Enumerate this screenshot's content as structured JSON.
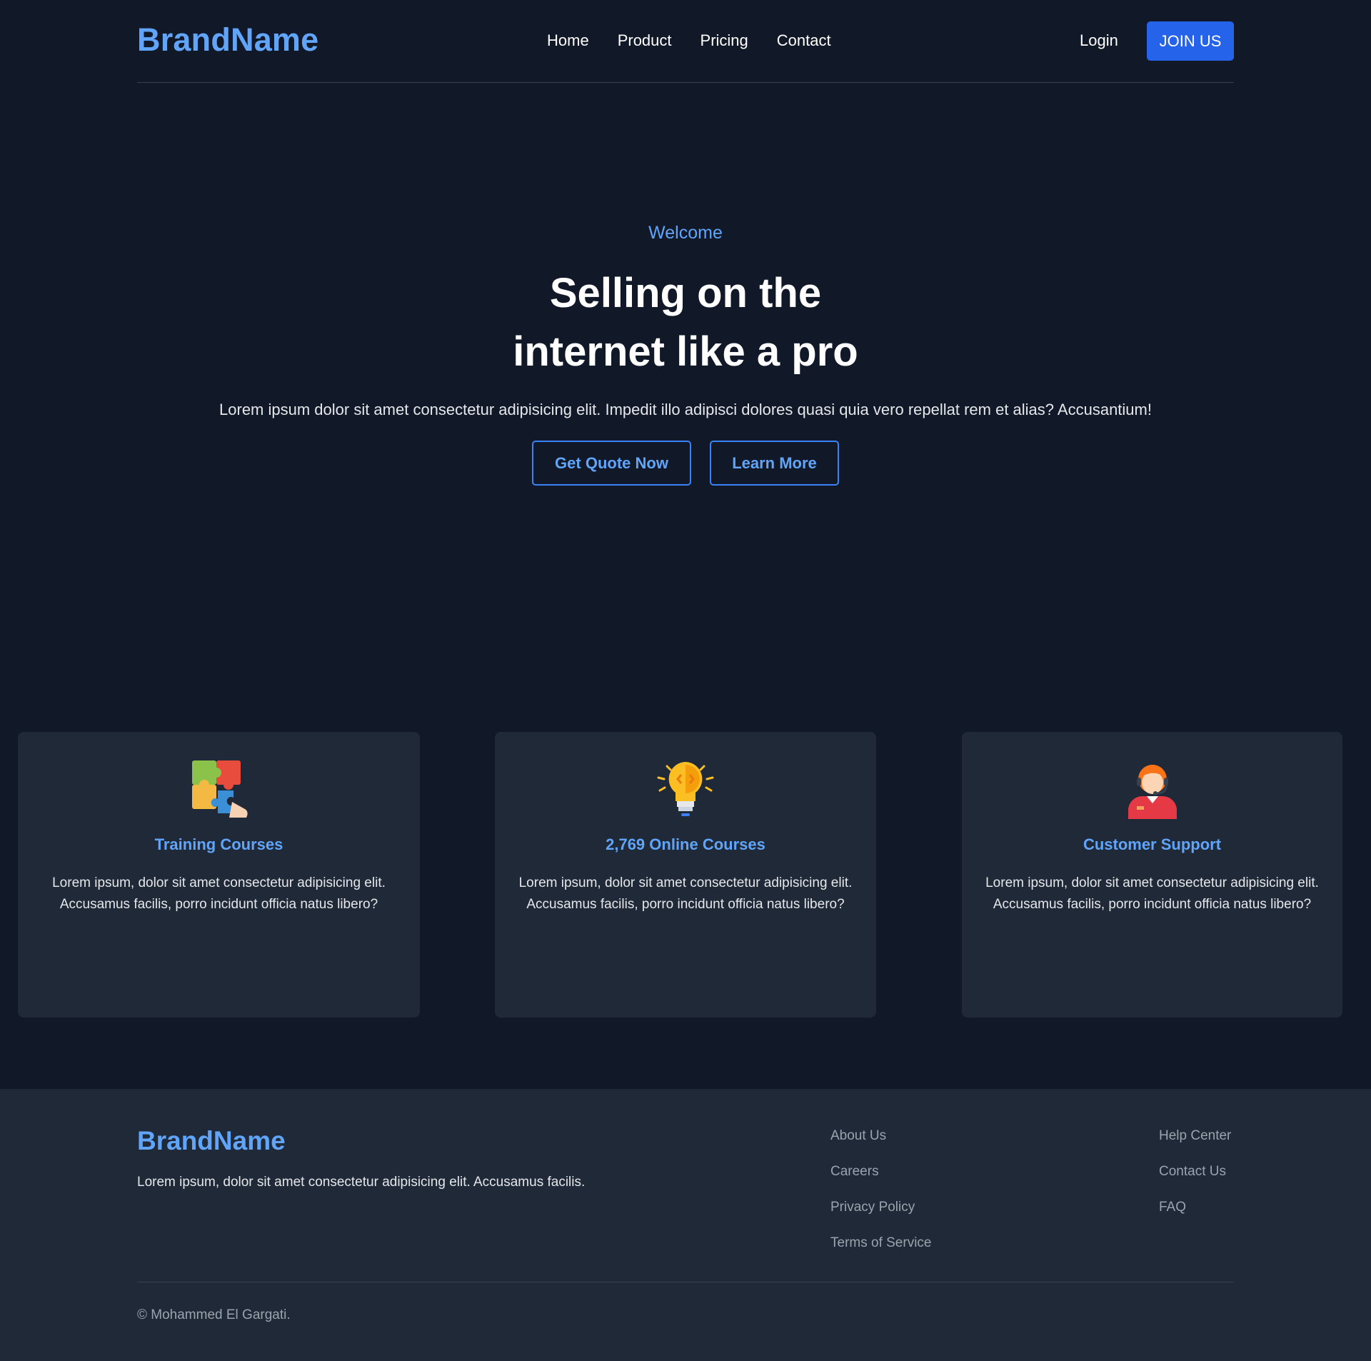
{
  "header": {
    "brand": "BrandName",
    "nav": [
      "Home",
      "Product",
      "Pricing",
      "Contact"
    ],
    "login_label": "Login",
    "join_label": "JOIN US"
  },
  "hero": {
    "eyebrow": "Welcome",
    "headline_line1": "Selling on the",
    "headline_line2": "internet like a pro",
    "description": "Lorem ipsum dolor sit amet consectetur adipisicing elit. Impedit illo adipisci dolores quasi quia vero repellat rem et alias? Accusantium!",
    "primary_button": "Get Quote Now",
    "secondary_button": "Learn More"
  },
  "features": [
    {
      "icon": "puzzle-icon",
      "title": "Training Courses",
      "text": "Lorem ipsum, dolor sit amet consectetur adipisicing elit. Accusamus facilis, porro incidunt officia natus libero?"
    },
    {
      "icon": "lightbulb-icon",
      "title": "2,769 Online Courses",
      "text": "Lorem ipsum, dolor sit amet consectetur adipisicing elit. Accusamus facilis, porro incidunt officia natus libero?"
    },
    {
      "icon": "support-agent-icon",
      "title": "Customer Support",
      "text": "Lorem ipsum, dolor sit amet consectetur adipisicing elit. Accusamus facilis, porro incidunt officia natus libero?"
    }
  ],
  "footer": {
    "brand": "BrandName",
    "tagline": "Lorem ipsum, dolor sit amet consectetur adipisicing elit. Accusamus facilis.",
    "links_col1": [
      "About Us",
      "Careers",
      "Privacy Policy",
      "Terms of Service"
    ],
    "links_col2": [
      "Help Center",
      "Contact Us",
      "FAQ"
    ],
    "copyright": "© Mohammed El Gargati."
  },
  "colors": {
    "background": "#111827",
    "surface": "#1f2937",
    "accent": "#60a5fa",
    "primary_button": "#2563eb"
  }
}
